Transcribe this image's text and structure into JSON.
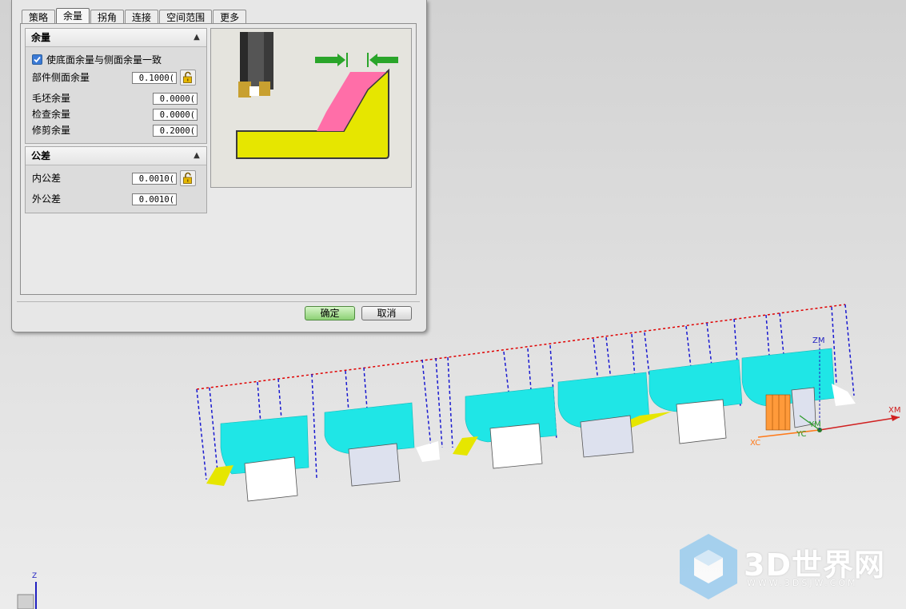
{
  "tabs": [
    "策略",
    "余量",
    "拐角",
    "连接",
    "空间范围",
    "更多"
  ],
  "active_tab": 1,
  "stock_group": {
    "title": "余量",
    "checkbox_label": "使底面余量与侧面余量一致",
    "checkbox_checked": true,
    "part_side_label": "部件侧面余量",
    "part_side_value": "0.1000(",
    "blank_label": "毛坯余量",
    "blank_value": "0.0000(",
    "check_label": "检查余量",
    "check_value": "0.0000(",
    "trim_label": "修剪余量",
    "trim_value": "0.2000("
  },
  "tolerance_group": {
    "title": "公差",
    "intol_label": "内公差",
    "intol_value": "0.0010(",
    "outtol_label": "外公差",
    "outtol_value": "0.0010("
  },
  "buttons": {
    "ok": "确定",
    "cancel": "取消"
  },
  "axes": {
    "zm": "ZM",
    "xm": "XM",
    "xc": "XC",
    "yc": "YC",
    "ym": "YM",
    "z": "Z"
  },
  "watermark": {
    "brand": "3D世界网",
    "url": "WWW.3DSJW.COM"
  },
  "colors": {
    "part_cyan": "#1fe6e6",
    "stock_pink": "#ff6ea8",
    "part_yellow": "#e6e600",
    "arrow_green": "#2aa52a",
    "path_red": "#e00000",
    "path_blue": "#1a1ad0",
    "ok_green": "#8dd175"
  }
}
